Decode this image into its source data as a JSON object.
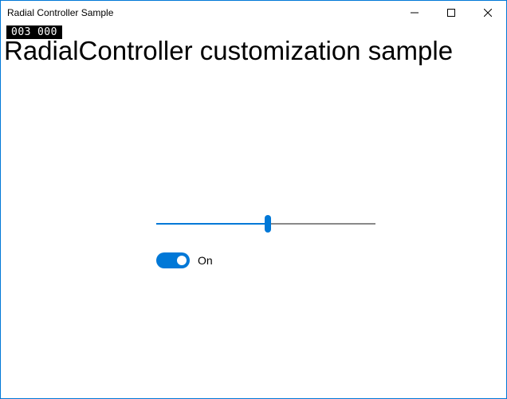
{
  "window": {
    "title": "Radial Controller Sample"
  },
  "debug": {
    "frame1": "003",
    "frame2": "000"
  },
  "page": {
    "heading": "RadialController customization sample"
  },
  "slider": {
    "value": 51,
    "min": 0,
    "max": 100
  },
  "toggle": {
    "state": "On",
    "checked": true
  }
}
